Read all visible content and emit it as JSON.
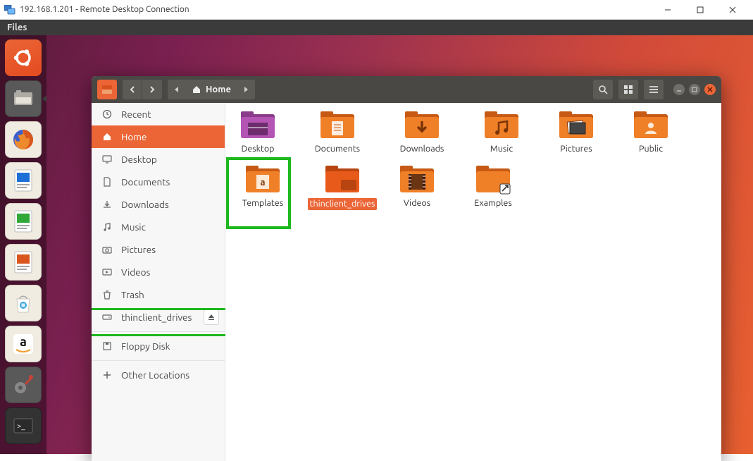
{
  "window": {
    "title": "192.168.1.201 - Remote Desktop Connection"
  },
  "unity": {
    "menubar_label": "Files"
  },
  "nautilus": {
    "toolbar": {
      "location_label": "Home"
    },
    "sidebar": {
      "items": [
        {
          "id": "recent",
          "label": "Recent"
        },
        {
          "id": "home",
          "label": "Home"
        },
        {
          "id": "desktop",
          "label": "Desktop"
        },
        {
          "id": "documents",
          "label": "Documents"
        },
        {
          "id": "downloads",
          "label": "Downloads"
        },
        {
          "id": "music",
          "label": "Music"
        },
        {
          "id": "pictures",
          "label": "Pictures"
        },
        {
          "id": "videos",
          "label": "Videos"
        },
        {
          "id": "trash",
          "label": "Trash"
        },
        {
          "id": "thinclient",
          "label": "thinclient_drives"
        },
        {
          "id": "floppy",
          "label": "Floppy Disk"
        },
        {
          "id": "other",
          "label": "Other Locations"
        }
      ]
    },
    "content": {
      "items": [
        {
          "id": "desktop",
          "label": "Desktop"
        },
        {
          "id": "documents",
          "label": "Documents"
        },
        {
          "id": "downloads",
          "label": "Downloads"
        },
        {
          "id": "music",
          "label": "Music"
        },
        {
          "id": "pictures",
          "label": "Pictures"
        },
        {
          "id": "public",
          "label": "Public"
        },
        {
          "id": "templates",
          "label": "Templates"
        },
        {
          "id": "thinclient",
          "label": "thinclient_drives"
        },
        {
          "id": "videos",
          "label": "Videos"
        },
        {
          "id": "examples",
          "label": "Examples"
        }
      ]
    }
  }
}
